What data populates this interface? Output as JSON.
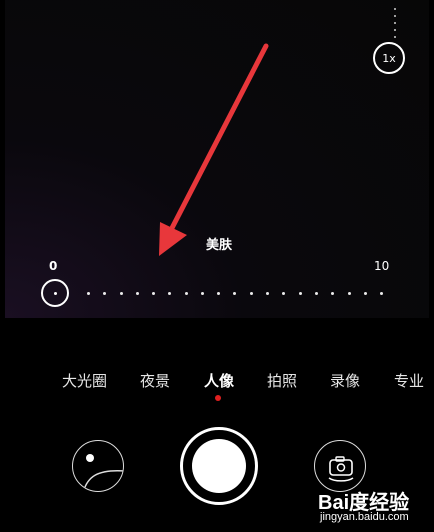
{
  "zoom": {
    "label": "1x"
  },
  "beauty": {
    "title": "美肤",
    "min": "0",
    "max": "10",
    "value": 0
  },
  "modes": {
    "items": [
      {
        "label": "大光圈"
      },
      {
        "label": "夜景"
      },
      {
        "label": "人像"
      },
      {
        "label": "拍照"
      },
      {
        "label": "录像"
      },
      {
        "label": "专业"
      }
    ],
    "active_index": 2
  },
  "controls": {
    "gallery_icon": "gallery-thumbnail-icon",
    "shutter_icon": "shutter-icon",
    "switch_icon": "camera-switch-icon"
  },
  "watermark": {
    "logo": "Bai度经验",
    "url": "jingyan.baidu.com"
  },
  "colors": {
    "accent": "#e02020",
    "annotation_arrow": "#e8373b"
  }
}
